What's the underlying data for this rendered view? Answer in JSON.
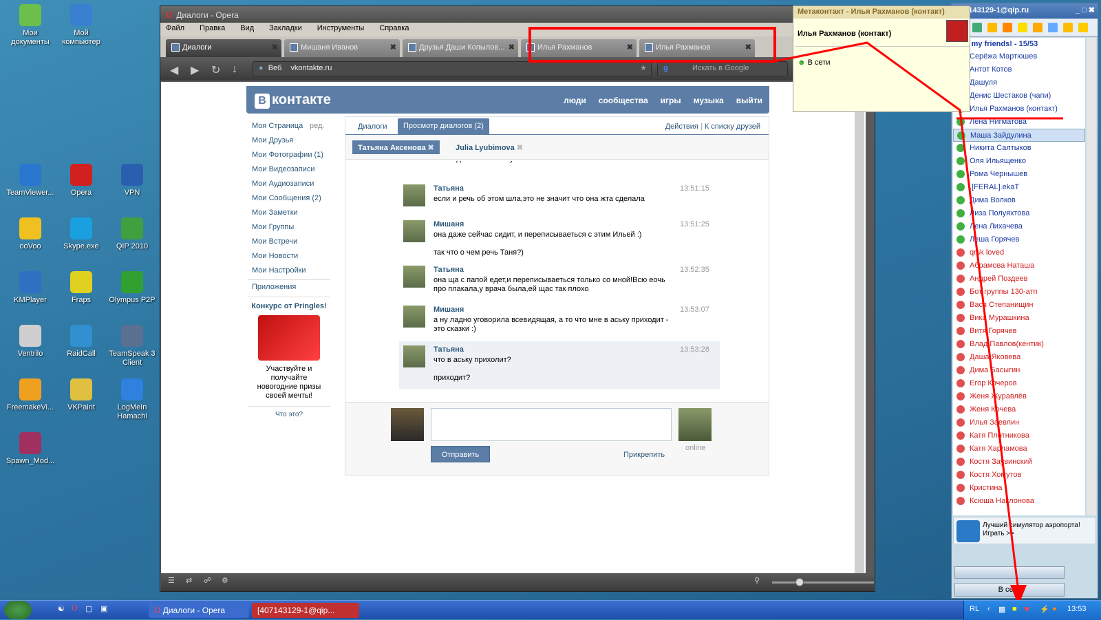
{
  "desktop": {
    "icons": [
      {
        "label": "Мои документы",
        "color": "#6bbf4a"
      },
      {
        "label": "Мой компьютер",
        "color": "#3a7fd0"
      },
      {
        "label": "TeamViewer...",
        "color": "#2a77d0"
      },
      {
        "label": "Opera",
        "color": "#d02020"
      },
      {
        "label": "VPN",
        "color": "#2a5fb0"
      },
      {
        "label": "ooVoo",
        "color": "#f0c020"
      },
      {
        "label": "Skype.exe",
        "color": "#1aa0e0"
      },
      {
        "label": "QIP 2010",
        "color": "#40a040"
      },
      {
        "label": "KMPlayer",
        "color": "#3070c0"
      },
      {
        "label": "Fraps",
        "color": "#e0d020"
      },
      {
        "label": "Olympus P2P",
        "color": "#30a030"
      },
      {
        "label": "Ventrilo",
        "color": "#cfcfcf"
      },
      {
        "label": "RaidCall",
        "color": "#3090d0"
      },
      {
        "label": "TeamSpeak 3 Client",
        "color": "#5a7090"
      },
      {
        "label": "FreemakeVi...",
        "color": "#f0a020"
      },
      {
        "label": "VKPaint",
        "color": "#e0c040"
      },
      {
        "label": "LogMeIn Hamachi",
        "color": "#3080e0"
      },
      {
        "label": "Spawn_Mod...",
        "color": "#a03060"
      }
    ]
  },
  "opera": {
    "title": "Диалоги - Opera",
    "menu": [
      "Файл",
      "Правка",
      "Вид",
      "Закладки",
      "Инструменты",
      "Справка"
    ],
    "tabs": [
      "Диалоги",
      "Мишаня Иванов",
      "Друзья Даши Копылов...",
      "Илья Рахманов",
      "Илья Рахманов"
    ],
    "address_label": "Веб",
    "address": "vkontakte.ru",
    "search_placeholder": "Искать в Google"
  },
  "vk": {
    "logo": "контакте",
    "logo_letter": "В",
    "top_links": [
      "люди",
      "сообщества",
      "игры",
      "музыка",
      "выйти"
    ],
    "left_menu": [
      "Моя Страница",
      "Мои Друзья",
      "Мои Фотографии (1)",
      "Мои Видеозаписи",
      "Мои Аудиозаписи",
      "Мои Сообщения (2)",
      "Мои Заметки",
      "Мои Группы",
      "Мои Встречи",
      "Мои Новости",
      "Мои Настройки"
    ],
    "edit_label": "ред.",
    "apps": "Приложения",
    "ad_title": "Конкурс от Pringles!",
    "ad_text": "Участвуйте и получайте новогодние призы своей мечты!",
    "ad_what": "Что это?",
    "tab_dialogs": "Диалоги",
    "tab_view": "Просмотр диалогов (2)",
    "actions": "Действия",
    "sep": "|",
    "to_friends": "К списку друзей",
    "people": [
      "Татьяна Аксенова",
      "Julia Lyubimova"
    ],
    "messages": [
      {
        "name": "",
        "time": "",
        "text": "на обед хочешь лапшу похавать?"
      },
      {
        "name": "Татьяна",
        "time": "13:51:15",
        "text": "если и речь об этом шла,это не значит что она жта сделала"
      },
      {
        "name": "Мишаня",
        "time": "13:51:25",
        "text": "она даже сейчас сидит, и переписываеться с этим Ильей :)",
        "text2": "так что о чем речь Таня?)"
      },
      {
        "name": "Татьяна",
        "time": "13:52:35",
        "text": "она ща с папой едет,и переписываеться только со мной!Всю еочь про плакала,у врача была,ей щас так плохо"
      },
      {
        "name": "Мишаня",
        "time": "13:53:07",
        "text": "а ну ладно уговорила всевидящая, а то что мне в аську приходит - это сказки :)"
      },
      {
        "name": "Татьяна",
        "time": "13:53:28",
        "text": "что в аську прихолит?",
        "text2": "приходит?"
      }
    ],
    "send": "Отправить",
    "attach": "Прикрепить",
    "online": "online"
  },
  "tooltip": {
    "title": "Метаконтакт - Илья Рахманов (контакт)",
    "name": "Илья Рахманов (контакт)",
    "status": "В сети"
  },
  "qip": {
    "title": "407143129-1@qip.ru",
    "group": "The my friends! - 15/53",
    "contacts": [
      {
        "name": "Серёжа Мартюшев",
        "color": "#1a3aa0"
      },
      {
        "name": "Антот Котов",
        "color": "#1a3aa0"
      },
      {
        "name": "Дашуля",
        "color": "#1a3aa0"
      },
      {
        "name": "Денис Шестаков (чапи)",
        "color": "#1a3aa0"
      },
      {
        "name": "Илья Рахманов (контакт)",
        "color": "#1a3aa0"
      },
      {
        "name": "Лена Нигматова",
        "color": "#1a3aa0"
      },
      {
        "name": "Маша Зайдулина",
        "color": "#1a3aa0"
      },
      {
        "name": "Никита Салтыков",
        "color": "#1a3aa0"
      },
      {
        "name": "Оля Ильященко",
        "color": "#1a3aa0"
      },
      {
        "name": "Рома Чернышев",
        "color": "#1a3aa0"
      },
      {
        "name": ".[FERAL].ekaT",
        "color": "#1a3aa0"
      },
      {
        "name": "Дима Волков",
        "color": "#1a3aa0"
      },
      {
        "name": "Лиза Полуяхтова",
        "color": "#1a3aa0"
      },
      {
        "name": "Лена Лихачева",
        "color": "#1a3aa0"
      },
      {
        "name": "Леша Горячев",
        "color": "#1a3aa0"
      },
      {
        "name": "qrsk loved",
        "color": "#d02020"
      },
      {
        "name": "Абрамова Наташа",
        "color": "#d02020"
      },
      {
        "name": "Андрей Поздеев",
        "color": "#d02020"
      },
      {
        "name": "Бот группы 130-атп",
        "color": "#d02020"
      },
      {
        "name": "Вася Степанищин",
        "color": "#d02020"
      },
      {
        "name": "Вика Мурашкина",
        "color": "#d02020"
      },
      {
        "name": "Витя Горячев",
        "color": "#d02020"
      },
      {
        "name": "Влад Павлов(кентик)",
        "color": "#d02020"
      },
      {
        "name": "Даша Яковева",
        "color": "#d02020"
      },
      {
        "name": "Дима Басыгин",
        "color": "#d02020"
      },
      {
        "name": "Егор Кочеров",
        "color": "#d02020"
      },
      {
        "name": "Женя Журавлёв",
        "color": "#d02020"
      },
      {
        "name": "Женя Кочева",
        "color": "#d02020"
      },
      {
        "name": "Илья Заевлин",
        "color": "#d02020"
      },
      {
        "name": "Катя Плотникова",
        "color": "#d02020"
      },
      {
        "name": "Катя Харламова",
        "color": "#d02020"
      },
      {
        "name": "Костя Заувинский",
        "color": "#d02020"
      },
      {
        "name": "Костя Хомутов",
        "color": "#d02020"
      },
      {
        "name": "Кристина",
        "color": "#d02020"
      },
      {
        "name": "Ксюша Наклонова",
        "color": "#d02020"
      }
    ],
    "ad": "Лучший симулятор аэропорта! Играть >>",
    "status": "В сети"
  },
  "taskbar": {
    "items": [
      "Диалоги - Opera",
      "[407143129-1@qip..."
    ],
    "lang": "RL",
    "clock": "13:53"
  }
}
